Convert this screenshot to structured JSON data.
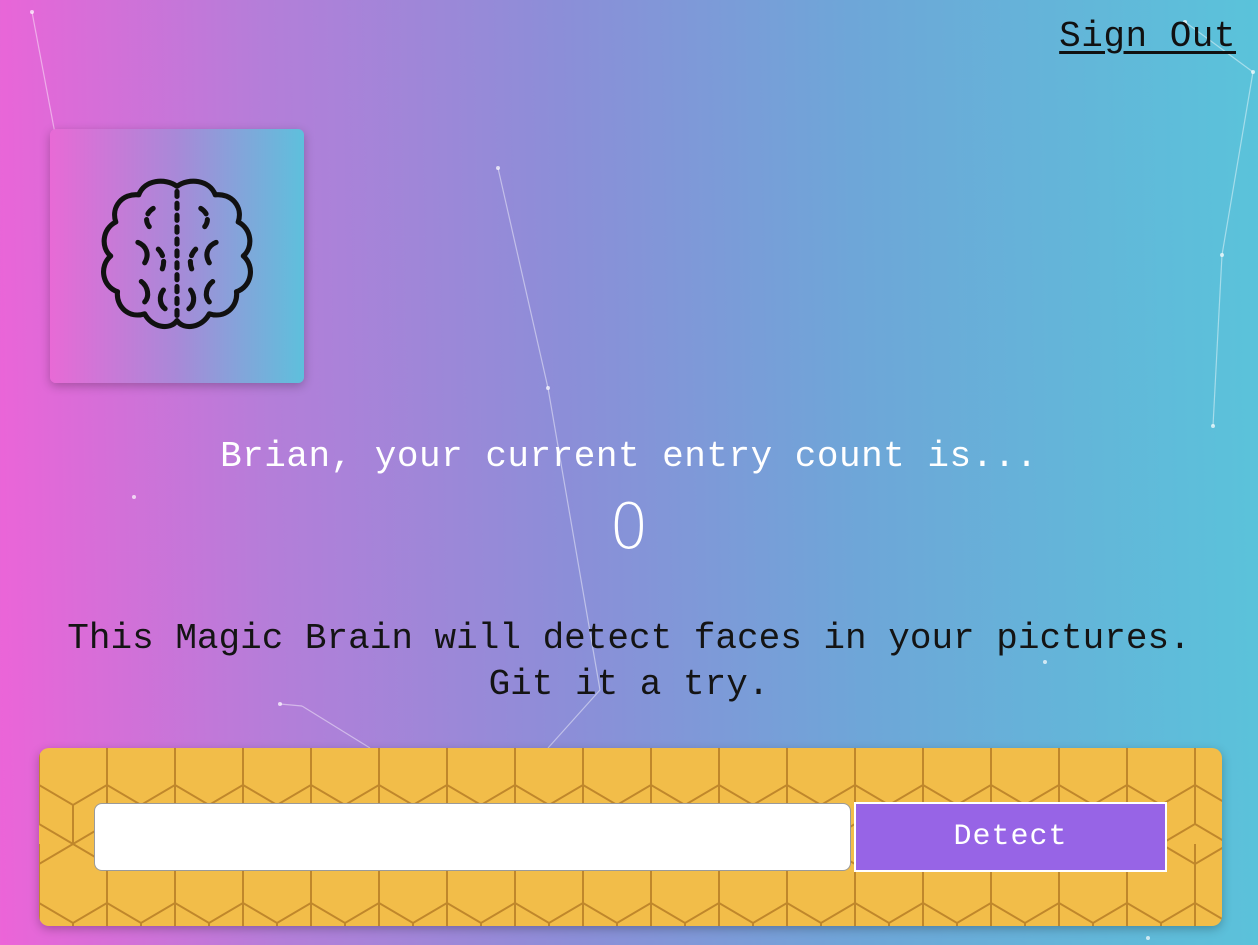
{
  "nav": {
    "signout_label": "Sign Out"
  },
  "logo": {
    "icon": "brain-icon"
  },
  "rank": {
    "message": "Brian, your current entry count is...",
    "count": "0"
  },
  "description": {
    "line1": "This Magic Brain will detect faces in your pictures.",
    "line2": "Git it a try."
  },
  "image_form": {
    "input_value": "",
    "input_placeholder": "",
    "button_label": "Detect"
  },
  "colors": {
    "gradient_left": "#ec64d8",
    "gradient_right": "#5ac3da",
    "panel": "#f2bd49",
    "button": "#9764e6",
    "text_light": "#ffffff",
    "text_dark": "#141414"
  }
}
